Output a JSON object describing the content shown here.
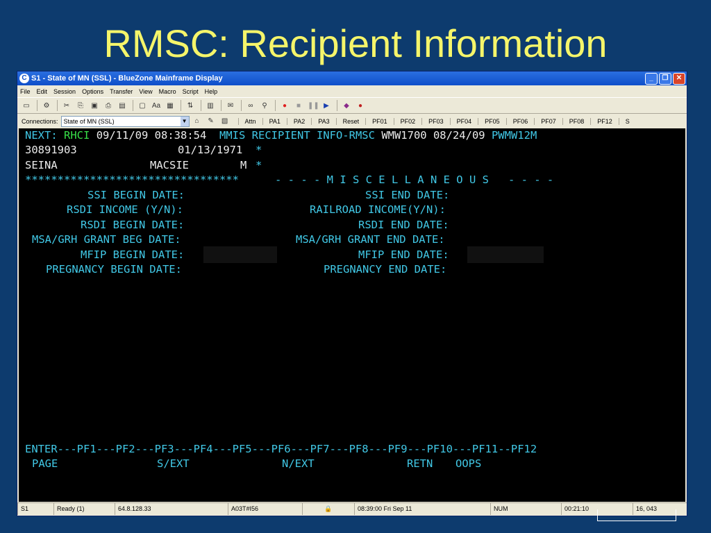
{
  "slide": {
    "title": "RMSC: Recipient Information"
  },
  "window": {
    "title": "S1 - State of MN (SSL) - BlueZone Mainframe Display",
    "menu": [
      "File",
      "Edit",
      "Session",
      "Options",
      "Transfer",
      "View",
      "Macro",
      "Script",
      "Help"
    ],
    "connections_label": "Connections:",
    "connection_value": "State of MN (SSL)",
    "keys": [
      "Attn",
      "PA1",
      "PA2",
      "PA3",
      "Reset",
      "PF01",
      "PF02",
      "PF03",
      "PF04",
      "PF05",
      "PF06",
      "PF07",
      "PF08",
      "PF12",
      "S"
    ]
  },
  "screen": {
    "header": {
      "next_label": "NEXT:",
      "next_value": "RHCI",
      "datetime": "09/11/09 08:38:54",
      "screen_title": "MMIS RECIPIENT INFO-RMSC",
      "id_date": "WMW1700 08/24/09",
      "terminal_id": "PWMW12M"
    },
    "recipient": {
      "id": "30891903",
      "dob": "01/13/1971",
      "dob_mark": "*",
      "last_name": "SEINA",
      "first_name": "MACSIE",
      "sex": "M",
      "sex_mark": "*"
    },
    "stars": "*********************************",
    "section_title": "- - - - M I S C E L L A N E O U S   - - - -",
    "left_fields": [
      "SSI BEGIN DATE:",
      "RSDI INCOME (Y/N):",
      "RSDI BEGIN DATE:",
      "MSA/GRH GRANT BEG DATE:",
      "MFIP BEGIN DATE:",
      "PREGNANCY BEGIN DATE:"
    ],
    "right_fields": [
      "SSI END DATE:",
      "RAILROAD INCOME(Y/N):",
      "RSDI END DATE:",
      "MSA/GRH GRANT END DATE:",
      "MFIP END DATE:",
      "PREGNANCY END DATE:"
    ],
    "pf_line": "ENTER---PF1---PF2---PF3---PF4---PF5---PF6---PF7---PF8---PF9---PF10---PF11--PF12",
    "pf_labels": {
      "page": "PAGE",
      "s_ext": "S/EXT",
      "n_ext": "N/EXT",
      "retn": "RETN",
      "oops": "OOPS"
    }
  },
  "status": {
    "session": "S1",
    "state": "Ready (1)",
    "ip": "64.8.128.33",
    "host": "A03T#I56",
    "time": "08:39:00  Fri Sep 11",
    "num": "NUM",
    "elapsed": "00:21:10",
    "cursor": "16, 043"
  }
}
